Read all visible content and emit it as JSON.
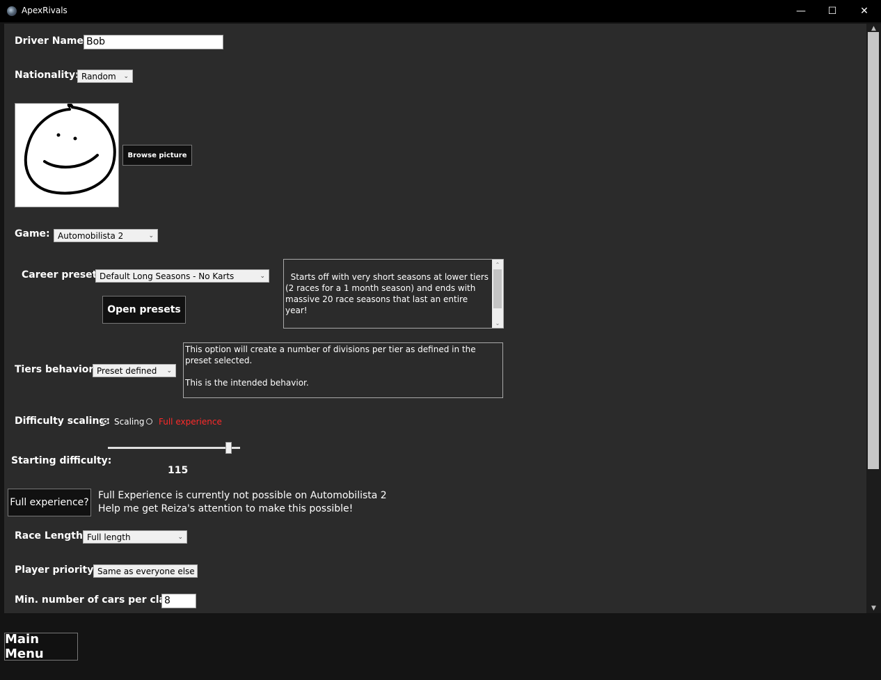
{
  "window": {
    "title": "ApexRivals",
    "minimize": "—",
    "maximize": "☐",
    "close": "✕"
  },
  "driver": {
    "label": "Driver Name:",
    "value": "Bob"
  },
  "nationality": {
    "label": "Nationality:",
    "value": "Random"
  },
  "picture": {
    "browse_label": "Browse picture"
  },
  "game": {
    "label": "Game:",
    "value": "Automobilista 2"
  },
  "career": {
    "label": "Career preset:",
    "value": "Default Long Seasons - No Karts",
    "open_label": "Open presets",
    "description": "Starts off with very short seasons at lower tiers (2 races for a 1 month season) and ends with massive 20 race seasons that last an entire year!\n\nThis path will gradually ramp up into epic seasons!"
  },
  "tiers": {
    "label": "Tiers behavior:",
    "value": "Preset defined",
    "description": "This option will create a number of divisions per tier as defined in the preset selected.\n\nThis is the intended behavior."
  },
  "difficulty_scaling": {
    "label": "Difficulty scaling:",
    "option_scaling": "Scaling",
    "option_full": "Full experience",
    "selected": "Scaling",
    "full_color": "#ff2a2a"
  },
  "starting_difficulty": {
    "label": "Starting difficulty:",
    "value": "115",
    "slider_fraction": 0.91
  },
  "full_experience": {
    "button_label": "Full experience?",
    "message_line1": "Full Experience is currently not possible on Automobilista 2",
    "message_line2": "Help me get Reiza's attention to make this possible!"
  },
  "race_length": {
    "label": "Race Length:",
    "value": "Full length"
  },
  "player_priority": {
    "label": "Player priority:",
    "value": "Same as everyone else"
  },
  "min_cars": {
    "label": "Min. number of cars per class:",
    "value": "8"
  },
  "nav": {
    "main_menu_label": "Main Menu"
  }
}
